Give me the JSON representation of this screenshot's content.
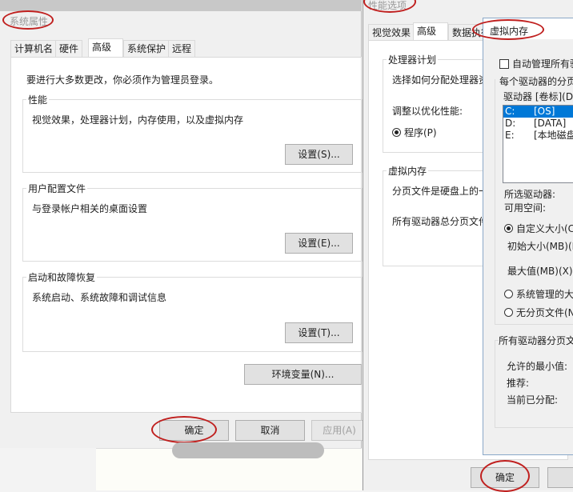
{
  "sys": {
    "title": "系统属性",
    "tabs": [
      "计算机名",
      "硬件",
      "高级",
      "系统保护",
      "远程"
    ],
    "notice": "要进行大多数更改，你必须作为管理员登录。",
    "perf": {
      "label": "性能",
      "desc": "视觉效果，处理器计划，内存使用，以及虚拟内存",
      "btn": "设置(S)..."
    },
    "profile": {
      "label": "用户配置文件",
      "desc": "与登录帐户相关的桌面设置",
      "btn": "设置(E)..."
    },
    "startup": {
      "label": "启动和故障恢复",
      "desc": "系统启动、系统故障和调试信息",
      "btn": "设置(T)..."
    },
    "env_btn": "环境变量(N)...",
    "ok": "确定",
    "cancel": "取消",
    "apply": "应用(A)"
  },
  "perfopt": {
    "title": "性能选项",
    "tabs": [
      "视觉效果",
      "高级",
      "数据执行"
    ],
    "cpu": {
      "label": "处理器计划",
      "desc": "选择如何分配处理器资",
      "adjust": "调整以优化性能:",
      "program": "程序(P)"
    },
    "vm": {
      "label": "虚拟内存",
      "desc": "分页文件是硬盘上的一",
      "total": "所有驱动器总分页文件"
    },
    "ok": "确定"
  },
  "vmem": {
    "title": "虚拟内存",
    "auto": "自动管理所有驱",
    "per_drive": "每个驱动器的分页",
    "drive_header": "驱动器 [卷标](D)",
    "drives": [
      {
        "letter": "C:",
        "label": "[OS]"
      },
      {
        "letter": "D:",
        "label": "[DATA]"
      },
      {
        "letter": "E:",
        "label": "[本地磁盘"
      }
    ],
    "selected": "所选驱动器:",
    "free": "可用空间:",
    "custom": "自定义大小(C",
    "initial": "初始大小(MB)(I)",
    "max": "最大值(MB)(X):",
    "system": "系统管理的大",
    "none": "无分页文件(N",
    "total_label": "所有驱动器分页文",
    "min": "允许的最小值:",
    "recommended": "推荐:",
    "current": "当前已分配:"
  }
}
